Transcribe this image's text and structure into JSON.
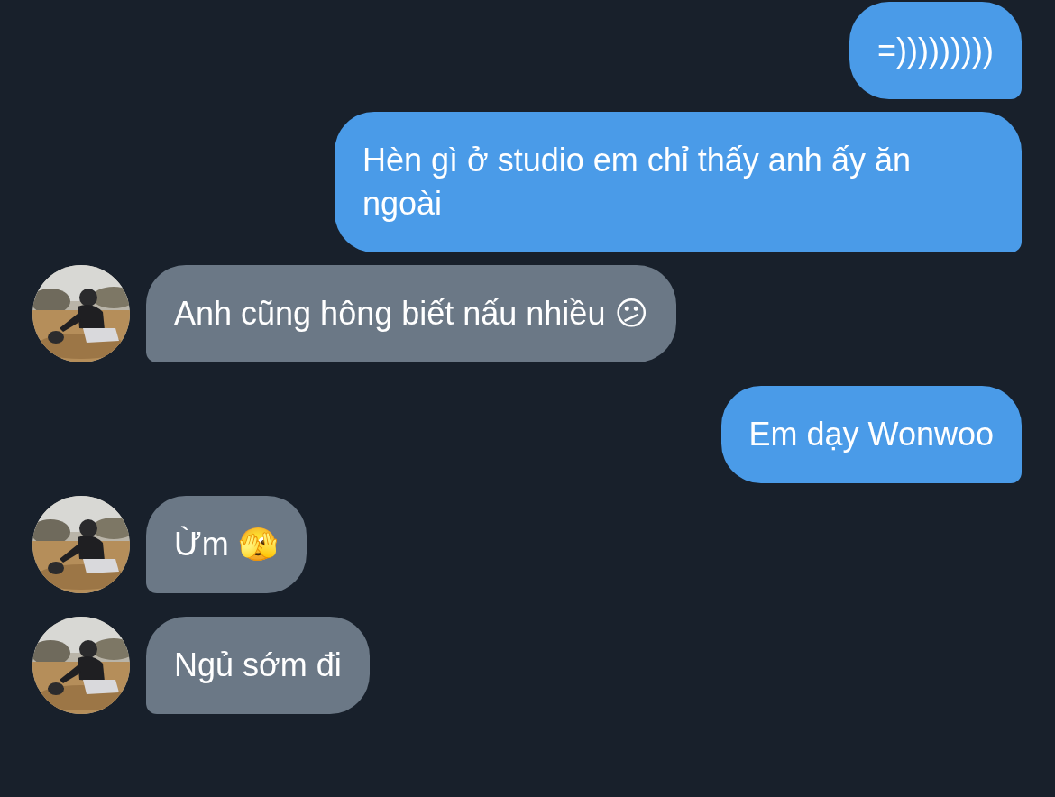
{
  "messages": [
    {
      "kind": "outgoing",
      "text": "=)))))))))"
    },
    {
      "kind": "outgoing",
      "text": "Hèn gì ở studio em chỉ thấy anh ấy ăn ngoài"
    },
    {
      "kind": "incoming",
      "text": "Anh cũng hông biết nấu nhiều 😕"
    },
    {
      "kind": "outgoing",
      "text": "Em dạy Wonwoo"
    },
    {
      "kind": "incoming",
      "text": "Ừm 🫣"
    },
    {
      "kind": "incoming",
      "text": "Ngủ sớm đi"
    }
  ]
}
